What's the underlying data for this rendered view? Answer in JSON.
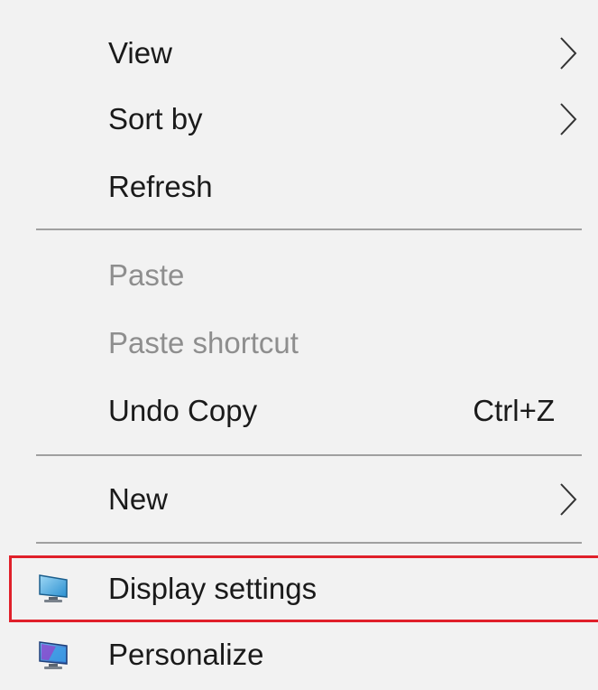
{
  "menu": {
    "view": "View",
    "sort_by": "Sort by",
    "refresh": "Refresh",
    "paste": "Paste",
    "paste_shortcut": "Paste shortcut",
    "undo_copy": "Undo Copy",
    "undo_copy_shortcut": "Ctrl+Z",
    "new": "New",
    "display_settings": "Display settings",
    "personalize": "Personalize"
  },
  "icons": {
    "display_settings": "display-monitor-icon",
    "personalize": "personalize-monitor-icon",
    "submenu": "chevron-right-icon"
  },
  "colors": {
    "highlight_border": "#e0202a",
    "disabled_text": "#8e8e8e"
  }
}
